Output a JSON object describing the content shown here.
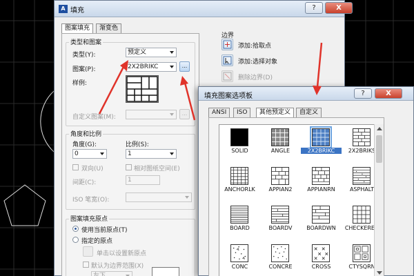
{
  "main_dialog": {
    "title": "填充",
    "help_label": "?",
    "close_label": "X",
    "tabs": [
      "图案填充",
      "渐变色"
    ],
    "type_group": {
      "title": "类型和图案",
      "type_label": "类型(Y):",
      "type_value": "预定义",
      "pattern_label": "图案(P):",
      "pattern_value": "2X2BRIKC",
      "pattern_browse": "...",
      "sample_label": "样例:",
      "custom_label": "自定义图案(M):",
      "custom_browse": "..."
    },
    "angle_group": {
      "title": "角度和比例",
      "angle_label": "角度(G):",
      "angle_value": "0",
      "scale_label": "比例(S):",
      "scale_value": "1",
      "double_label": "双向(U)",
      "relative_label": "相对图纸空间(E)",
      "spacing_label": "间距(C):",
      "spacing_value": "1",
      "iso_label": "ISO 笔宽(O):"
    },
    "origin_group": {
      "title": "图案填充原点",
      "current_origin": "使用当前原点(T)",
      "specified_origin": "指定的原点",
      "click_new_origin": "单击以设置新原点",
      "default_extent": "默认为边界范围(X)",
      "position_value": "左下"
    },
    "boundary": {
      "title": "边界",
      "add_pick": "添加:拾取点",
      "add_select": "添加:选择对象",
      "remove": "删除边界(D)"
    }
  },
  "palette_dialog": {
    "title": "填充图案选项板",
    "help_label": "?",
    "close_label": "X",
    "tabs": [
      "ANSI",
      "ISO",
      "其他预定义",
      "自定义"
    ],
    "active_tab": "其他预定义",
    "selected_pattern": "2X2BRIKC",
    "patterns": [
      {
        "name": "SOLID",
        "icon": "solid-icon"
      },
      {
        "name": "ANGLE",
        "icon": "angle-icon"
      },
      {
        "name": "2X2BRIKC",
        "icon": "brick-grid-icon"
      },
      {
        "name": "2X2BRIKS",
        "icon": "brick-icon"
      },
      {
        "name": "ANCHORLK",
        "icon": "anchorlk-icon"
      },
      {
        "name": "APPIAN2",
        "icon": "appian-icon"
      },
      {
        "name": "APPIANRN",
        "icon": "appianrn-icon"
      },
      {
        "name": "ASPHALT",
        "icon": "asphalt-icon"
      },
      {
        "name": "BOARD",
        "icon": "board-icon"
      },
      {
        "name": "BOARDV",
        "icon": "boardv-icon"
      },
      {
        "name": "BOARDWN",
        "icon": "boardwn-icon"
      },
      {
        "name": "CHECKERED",
        "icon": "checkered-icon"
      },
      {
        "name": "CONC",
        "icon": "conc-icon"
      },
      {
        "name": "CONCRE",
        "icon": "concre-icon"
      },
      {
        "name": "CROSS",
        "icon": "cross-icon"
      },
      {
        "name": "CTYSQRN",
        "icon": "ctysqrn-icon"
      }
    ]
  },
  "colors": {
    "accent": "#3b74c4",
    "annotation_arrow": "#e0332a",
    "titlebar": "#d4e1f1"
  }
}
